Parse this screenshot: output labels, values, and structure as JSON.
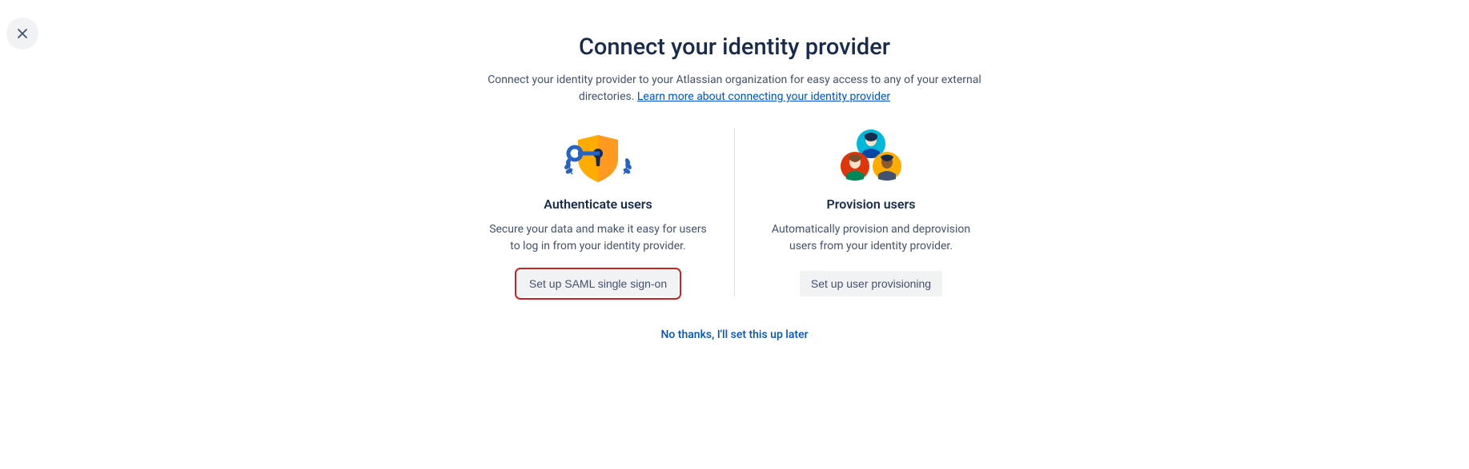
{
  "header": {
    "title": "Connect your identity provider",
    "subtitle_pre": "Connect your identity provider to your Atlassian organization for easy access to any of your external directories. ",
    "subtitle_link": "Learn more about connecting your identity provider"
  },
  "cards": {
    "authenticate": {
      "title": "Authenticate users",
      "description": "Secure your data and make it easy for users to log in from your identity provider.",
      "button": "Set up SAML single sign-on"
    },
    "provision": {
      "title": "Provision users",
      "description": "Automatically provision and deprovision users from your identity provider.",
      "button": "Set up user provisioning"
    }
  },
  "skip": "No thanks, I'll set this up later"
}
